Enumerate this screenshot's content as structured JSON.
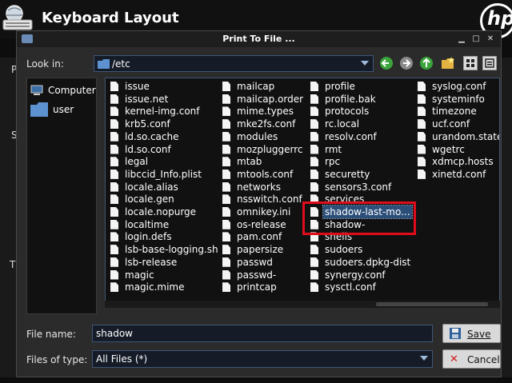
{
  "background": {
    "app_title": "Keyboard Layout",
    "logo_text": "hp",
    "left_letters": [
      "P",
      "S",
      "T"
    ]
  },
  "dialog": {
    "title": "Print To File ...",
    "look_in_label": "Look in:",
    "look_in_value": "/etc",
    "places": [
      {
        "label": "Computer",
        "icon": "computer-icon"
      },
      {
        "label": "user",
        "icon": "folder-icon"
      }
    ],
    "columns": [
      [
        "issue",
        "issue.net",
        "kernel-img.conf",
        "krb5.conf",
        "ld.so.cache",
        "ld.so.conf",
        "legal",
        "libccid_Info.plist",
        "locale.alias",
        "locale.gen",
        "locale.nopurge",
        "localtime",
        "login.defs",
        "lsb-base-logging.sh",
        "lsb-release",
        "magic",
        "magic.mime"
      ],
      [
        "mailcap",
        "mailcap.order",
        "mime.types",
        "mke2fs.conf",
        "modules",
        "mozpluggerrc",
        "mtab",
        "mtools.conf",
        "networks",
        "nsswitch.conf",
        "omnikey.ini",
        "os-release",
        "pam.conf",
        "papersize",
        "passwd",
        "passwd-",
        "printcap"
      ],
      [
        "profile",
        "profile.bak",
        "protocols",
        "rc.local",
        "resolv.conf",
        "rmt",
        "rpc",
        "securetty",
        "sensors3.conf",
        "services",
        "shadow-last-mo...",
        "shadow-",
        "shells",
        "sudoers",
        "sudoers.dpkg-dist",
        "synergy.conf",
        "sysctl.conf"
      ],
      [
        "syslog.conf",
        "systeminfo",
        "timezone",
        "ucf.conf",
        "urandom.state",
        "wgetrc",
        "xdmcp.hosts",
        "xinetd.conf"
      ]
    ],
    "selected_file": "shadow-last-mo...",
    "file_name_label": "File name:",
    "file_name_value": "shadow",
    "files_of_type_label": "Files of type:",
    "files_of_type_value": "All Files (*)",
    "save_label": "Save",
    "cancel_label": "Cancel",
    "colors": {
      "highlight": "#e00c1b",
      "selection": "#2c4f7a",
      "field_border": "#3f5676"
    }
  }
}
